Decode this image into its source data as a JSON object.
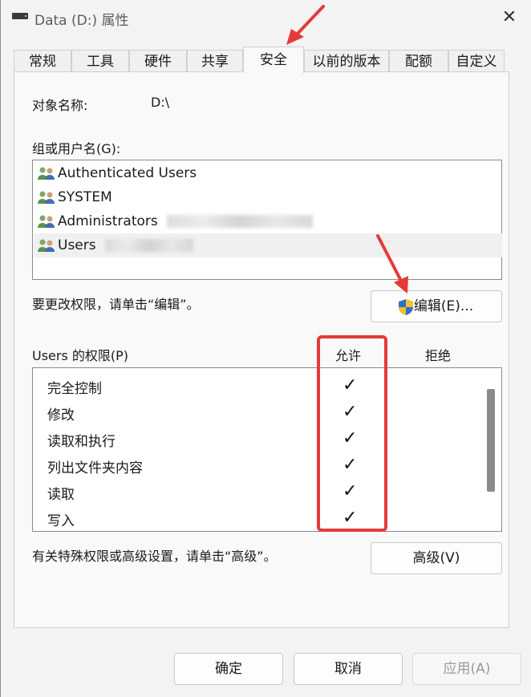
{
  "window": {
    "title": "Data (D:) 属性",
    "close_glyph": "✕"
  },
  "tabs": [
    {
      "label": "常规"
    },
    {
      "label": "工具"
    },
    {
      "label": "硬件"
    },
    {
      "label": "共享"
    },
    {
      "label": "安全",
      "active": true
    },
    {
      "label": "以前的版本"
    },
    {
      "label": "配额"
    },
    {
      "label": "自定义"
    }
  ],
  "security": {
    "object_name_label": "对象名称:",
    "object_name_value": "D:\\",
    "group_label": "组或用户名(G):",
    "users": [
      {
        "name": "Authenticated Users"
      },
      {
        "name": "SYSTEM"
      },
      {
        "name": "Administrators"
      },
      {
        "name": "Users",
        "selected": true
      }
    ],
    "edit_hint": "要更改权限，请单击“编辑”。",
    "edit_button": "编辑(E)...",
    "permissions_label": "Users 的权限(P)",
    "allow_header": "允许",
    "deny_header": "拒绝",
    "permissions": [
      {
        "name": "完全控制",
        "allow": "✓"
      },
      {
        "name": "修改",
        "allow": "✓"
      },
      {
        "name": "读取和执行",
        "allow": "✓"
      },
      {
        "name": "列出文件夹内容",
        "allow": "✓"
      },
      {
        "name": "读取",
        "allow": "✓"
      },
      {
        "name": "写入",
        "allow": "✓"
      }
    ],
    "advanced_hint": "有关特殊权限或高级设置，请单击“高级”。",
    "advanced_button": "高级(V)"
  },
  "footer": {
    "ok": "确定",
    "cancel": "取消",
    "apply": "应用(A)"
  },
  "colors": {
    "annotation_red": "#e53a3a",
    "selected_row": "#f0f0f0"
  }
}
